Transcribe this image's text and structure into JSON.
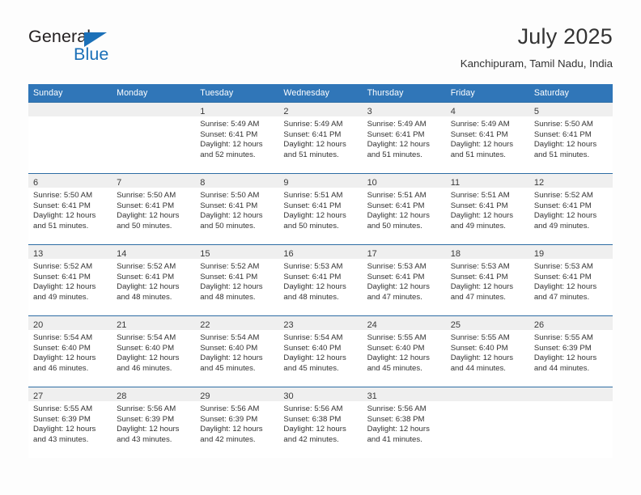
{
  "logo": {
    "word_one": "General",
    "word_two": "Blue",
    "triangle_color": "#1b70b8",
    "text_color": "#231f20",
    "blue_color": "#1b70b8"
  },
  "header": {
    "title": "July 2025",
    "subtitle": "Kanchipuram, Tamil Nadu, India"
  },
  "theme": {
    "header_blue": "#3076b8",
    "row_border_blue": "#2e6da4",
    "daynum_band": "#efefef",
    "text": "#333333"
  },
  "weekday_headers": [
    "Sunday",
    "Monday",
    "Tuesday",
    "Wednesday",
    "Thursday",
    "Friday",
    "Saturday"
  ],
  "weeks": [
    [
      {
        "day": "",
        "sunrise": "",
        "sunset": "",
        "daylight_line1": "",
        "daylight_line2": ""
      },
      {
        "day": "",
        "sunrise": "",
        "sunset": "",
        "daylight_line1": "",
        "daylight_line2": ""
      },
      {
        "day": "1",
        "sunrise": "Sunrise: 5:49 AM",
        "sunset": "Sunset: 6:41 PM",
        "daylight_line1": "Daylight: 12 hours",
        "daylight_line2": "and 52 minutes."
      },
      {
        "day": "2",
        "sunrise": "Sunrise: 5:49 AM",
        "sunset": "Sunset: 6:41 PM",
        "daylight_line1": "Daylight: 12 hours",
        "daylight_line2": "and 51 minutes."
      },
      {
        "day": "3",
        "sunrise": "Sunrise: 5:49 AM",
        "sunset": "Sunset: 6:41 PM",
        "daylight_line1": "Daylight: 12 hours",
        "daylight_line2": "and 51 minutes."
      },
      {
        "day": "4",
        "sunrise": "Sunrise: 5:49 AM",
        "sunset": "Sunset: 6:41 PM",
        "daylight_line1": "Daylight: 12 hours",
        "daylight_line2": "and 51 minutes."
      },
      {
        "day": "5",
        "sunrise": "Sunrise: 5:50 AM",
        "sunset": "Sunset: 6:41 PM",
        "daylight_line1": "Daylight: 12 hours",
        "daylight_line2": "and 51 minutes."
      }
    ],
    [
      {
        "day": "6",
        "sunrise": "Sunrise: 5:50 AM",
        "sunset": "Sunset: 6:41 PM",
        "daylight_line1": "Daylight: 12 hours",
        "daylight_line2": "and 51 minutes."
      },
      {
        "day": "7",
        "sunrise": "Sunrise: 5:50 AM",
        "sunset": "Sunset: 6:41 PM",
        "daylight_line1": "Daylight: 12 hours",
        "daylight_line2": "and 50 minutes."
      },
      {
        "day": "8",
        "sunrise": "Sunrise: 5:50 AM",
        "sunset": "Sunset: 6:41 PM",
        "daylight_line1": "Daylight: 12 hours",
        "daylight_line2": "and 50 minutes."
      },
      {
        "day": "9",
        "sunrise": "Sunrise: 5:51 AM",
        "sunset": "Sunset: 6:41 PM",
        "daylight_line1": "Daylight: 12 hours",
        "daylight_line2": "and 50 minutes."
      },
      {
        "day": "10",
        "sunrise": "Sunrise: 5:51 AM",
        "sunset": "Sunset: 6:41 PM",
        "daylight_line1": "Daylight: 12 hours",
        "daylight_line2": "and 50 minutes."
      },
      {
        "day": "11",
        "sunrise": "Sunrise: 5:51 AM",
        "sunset": "Sunset: 6:41 PM",
        "daylight_line1": "Daylight: 12 hours",
        "daylight_line2": "and 49 minutes."
      },
      {
        "day": "12",
        "sunrise": "Sunrise: 5:52 AM",
        "sunset": "Sunset: 6:41 PM",
        "daylight_line1": "Daylight: 12 hours",
        "daylight_line2": "and 49 minutes."
      }
    ],
    [
      {
        "day": "13",
        "sunrise": "Sunrise: 5:52 AM",
        "sunset": "Sunset: 6:41 PM",
        "daylight_line1": "Daylight: 12 hours",
        "daylight_line2": "and 49 minutes."
      },
      {
        "day": "14",
        "sunrise": "Sunrise: 5:52 AM",
        "sunset": "Sunset: 6:41 PM",
        "daylight_line1": "Daylight: 12 hours",
        "daylight_line2": "and 48 minutes."
      },
      {
        "day": "15",
        "sunrise": "Sunrise: 5:52 AM",
        "sunset": "Sunset: 6:41 PM",
        "daylight_line1": "Daylight: 12 hours",
        "daylight_line2": "and 48 minutes."
      },
      {
        "day": "16",
        "sunrise": "Sunrise: 5:53 AM",
        "sunset": "Sunset: 6:41 PM",
        "daylight_line1": "Daylight: 12 hours",
        "daylight_line2": "and 48 minutes."
      },
      {
        "day": "17",
        "sunrise": "Sunrise: 5:53 AM",
        "sunset": "Sunset: 6:41 PM",
        "daylight_line1": "Daylight: 12 hours",
        "daylight_line2": "and 47 minutes."
      },
      {
        "day": "18",
        "sunrise": "Sunrise: 5:53 AM",
        "sunset": "Sunset: 6:41 PM",
        "daylight_line1": "Daylight: 12 hours",
        "daylight_line2": "and 47 minutes."
      },
      {
        "day": "19",
        "sunrise": "Sunrise: 5:53 AM",
        "sunset": "Sunset: 6:41 PM",
        "daylight_line1": "Daylight: 12 hours",
        "daylight_line2": "and 47 minutes."
      }
    ],
    [
      {
        "day": "20",
        "sunrise": "Sunrise: 5:54 AM",
        "sunset": "Sunset: 6:40 PM",
        "daylight_line1": "Daylight: 12 hours",
        "daylight_line2": "and 46 minutes."
      },
      {
        "day": "21",
        "sunrise": "Sunrise: 5:54 AM",
        "sunset": "Sunset: 6:40 PM",
        "daylight_line1": "Daylight: 12 hours",
        "daylight_line2": "and 46 minutes."
      },
      {
        "day": "22",
        "sunrise": "Sunrise: 5:54 AM",
        "sunset": "Sunset: 6:40 PM",
        "daylight_line1": "Daylight: 12 hours",
        "daylight_line2": "and 45 minutes."
      },
      {
        "day": "23",
        "sunrise": "Sunrise: 5:54 AM",
        "sunset": "Sunset: 6:40 PM",
        "daylight_line1": "Daylight: 12 hours",
        "daylight_line2": "and 45 minutes."
      },
      {
        "day": "24",
        "sunrise": "Sunrise: 5:55 AM",
        "sunset": "Sunset: 6:40 PM",
        "daylight_line1": "Daylight: 12 hours",
        "daylight_line2": "and 45 minutes."
      },
      {
        "day": "25",
        "sunrise": "Sunrise: 5:55 AM",
        "sunset": "Sunset: 6:40 PM",
        "daylight_line1": "Daylight: 12 hours",
        "daylight_line2": "and 44 minutes."
      },
      {
        "day": "26",
        "sunrise": "Sunrise: 5:55 AM",
        "sunset": "Sunset: 6:39 PM",
        "daylight_line1": "Daylight: 12 hours",
        "daylight_line2": "and 44 minutes."
      }
    ],
    [
      {
        "day": "27",
        "sunrise": "Sunrise: 5:55 AM",
        "sunset": "Sunset: 6:39 PM",
        "daylight_line1": "Daylight: 12 hours",
        "daylight_line2": "and 43 minutes."
      },
      {
        "day": "28",
        "sunrise": "Sunrise: 5:56 AM",
        "sunset": "Sunset: 6:39 PM",
        "daylight_line1": "Daylight: 12 hours",
        "daylight_line2": "and 43 minutes."
      },
      {
        "day": "29",
        "sunrise": "Sunrise: 5:56 AM",
        "sunset": "Sunset: 6:39 PM",
        "daylight_line1": "Daylight: 12 hours",
        "daylight_line2": "and 42 minutes."
      },
      {
        "day": "30",
        "sunrise": "Sunrise: 5:56 AM",
        "sunset": "Sunset: 6:38 PM",
        "daylight_line1": "Daylight: 12 hours",
        "daylight_line2": "and 42 minutes."
      },
      {
        "day": "31",
        "sunrise": "Sunrise: 5:56 AM",
        "sunset": "Sunset: 6:38 PM",
        "daylight_line1": "Daylight: 12 hours",
        "daylight_line2": "and 41 minutes."
      },
      {
        "day": "",
        "sunrise": "",
        "sunset": "",
        "daylight_line1": "",
        "daylight_line2": ""
      },
      {
        "day": "",
        "sunrise": "",
        "sunset": "",
        "daylight_line1": "",
        "daylight_line2": ""
      }
    ]
  ]
}
